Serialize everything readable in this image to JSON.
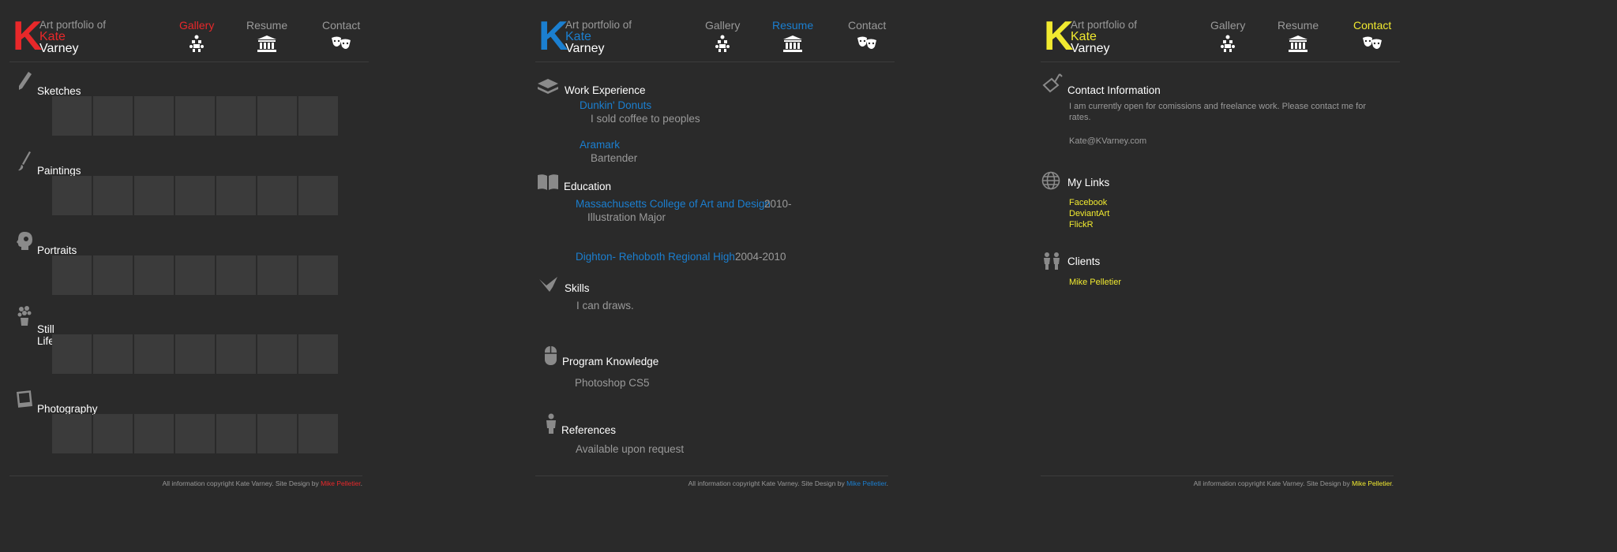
{
  "colors": {
    "red": "#e8282a",
    "blue": "#1b7fd0",
    "yellow": "#f1ea30",
    "bg": "#2a2a2a",
    "tile": "#3b3b3b"
  },
  "header": {
    "logo_letter": "K",
    "line1": "Art portfolio of",
    "first_name": "Kate",
    "last_name": "Varney"
  },
  "nav": {
    "gallery": {
      "label": "Gallery",
      "icon": "gallery-icon"
    },
    "resume": {
      "label": "Resume",
      "icon": "column-building-icon"
    },
    "contact": {
      "label": "Contact",
      "icon": "theater-masks-icon"
    }
  },
  "gallery": {
    "active_nav": "Gallery",
    "sections": [
      {
        "title": "Sketches",
        "icon": "pencil-icon"
      },
      {
        "title": "Paintings",
        "icon": "paintbrush-icon"
      },
      {
        "title": "Portraits",
        "icon": "head-profile-icon"
      },
      {
        "title": "Still Life",
        "icon": "flower-vase-icon"
      },
      {
        "title": "Photography",
        "icon": "polaroid-icon"
      }
    ]
  },
  "resume": {
    "active_nav": "Resume",
    "work": {
      "title": "Work Experience",
      "icon": "stack-icon",
      "jobs": [
        {
          "company": "Dunkin' Donuts",
          "desc": "I sold coffee to peoples"
        },
        {
          "company": "Aramark",
          "desc": "Bartender"
        }
      ]
    },
    "education": {
      "title": "Education",
      "icon": "open-book-icon",
      "schools": [
        {
          "name": "Massachusetts College of Art and Design",
          "years": "2010-",
          "detail": "Illustration Major"
        },
        {
          "name": "Dighton- Rehoboth Regional High",
          "years": "2004-2010"
        }
      ]
    },
    "skills": {
      "title": "Skills",
      "icon": "paper-crane-icon",
      "text": "I can draws."
    },
    "programs": {
      "title": "Program Knowledge",
      "icon": "mouse-icon",
      "text": "Photoshop CS5"
    },
    "references": {
      "title": "References",
      "icon": "person-icon",
      "text": "Available upon request"
    }
  },
  "contact": {
    "active_nav": "Contact",
    "info": {
      "title": "Contact Information",
      "icon": "mailbox-icon",
      "text": "I am currently open for comissions and freelance work. Please contact me for rates.",
      "email": "Kate@KVarney.com"
    },
    "links": {
      "title": "My Links",
      "icon": "globe-icon",
      "items": [
        "Facebook",
        "DeviantArt",
        "FlickR"
      ]
    },
    "clients": {
      "title": "Clients",
      "icon": "people-icon",
      "items": [
        "Mike Pelletier"
      ]
    }
  },
  "footer": {
    "text": "All information copyright Kate Varney. Site Design by ",
    "designer": "Mike Pelletier",
    "end": "."
  }
}
